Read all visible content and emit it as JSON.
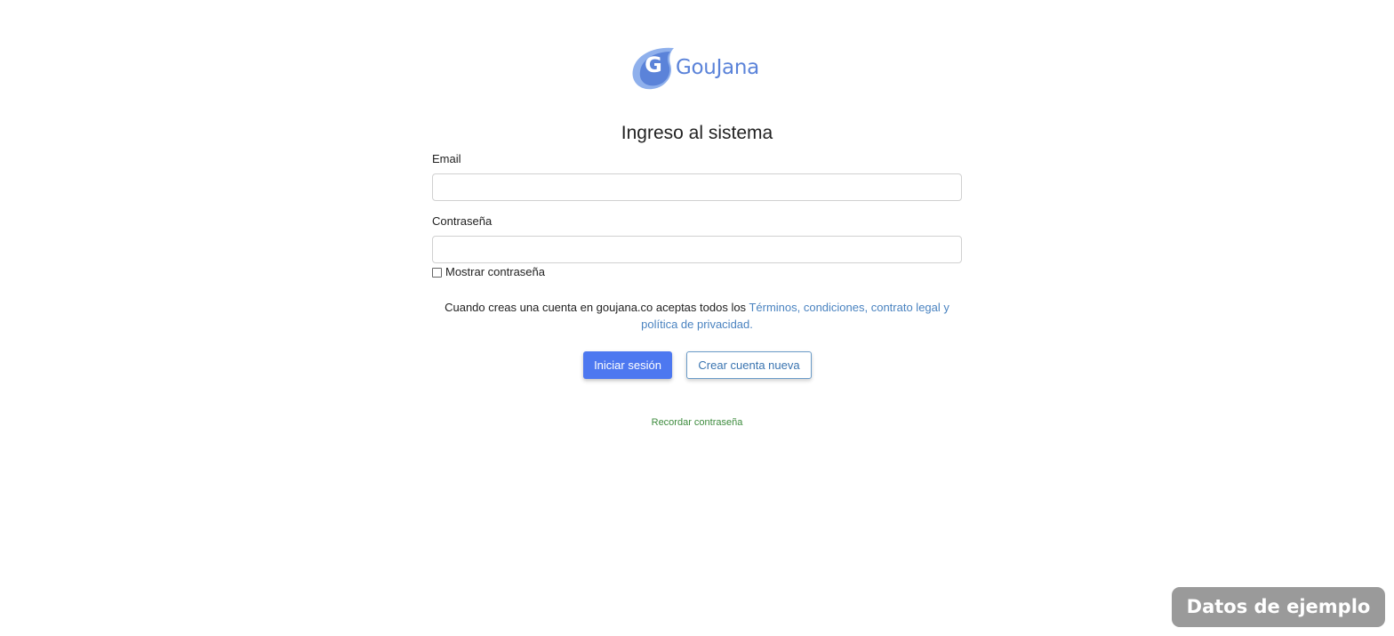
{
  "brand": {
    "logo_letter": "G",
    "name": "GouJana",
    "color": "#5b83d9"
  },
  "login": {
    "title": "Ingreso al sistema",
    "email_label": "Email",
    "email_value": "",
    "password_label": "Contraseña",
    "password_value": "",
    "show_password_label": "Mostrar contraseña",
    "show_password_checked": false
  },
  "terms": {
    "prefix": "Cuando creas una cuenta en goujana.co aceptas todos los ",
    "link_text": "Términos, condiciones, contrato legal y política de privacidad."
  },
  "actions": {
    "login_button": "Iniciar sesión",
    "create_account_button": "Crear cuenta nueva",
    "remember_password_link": "Recordar contraseña"
  },
  "badge": {
    "text": "Datos de ejemplo"
  },
  "colors": {
    "primary": "#4d78f0",
    "link": "#4a83c0",
    "remember_link": "#3d8b3d",
    "badge_bg": "#9a9a9a"
  }
}
